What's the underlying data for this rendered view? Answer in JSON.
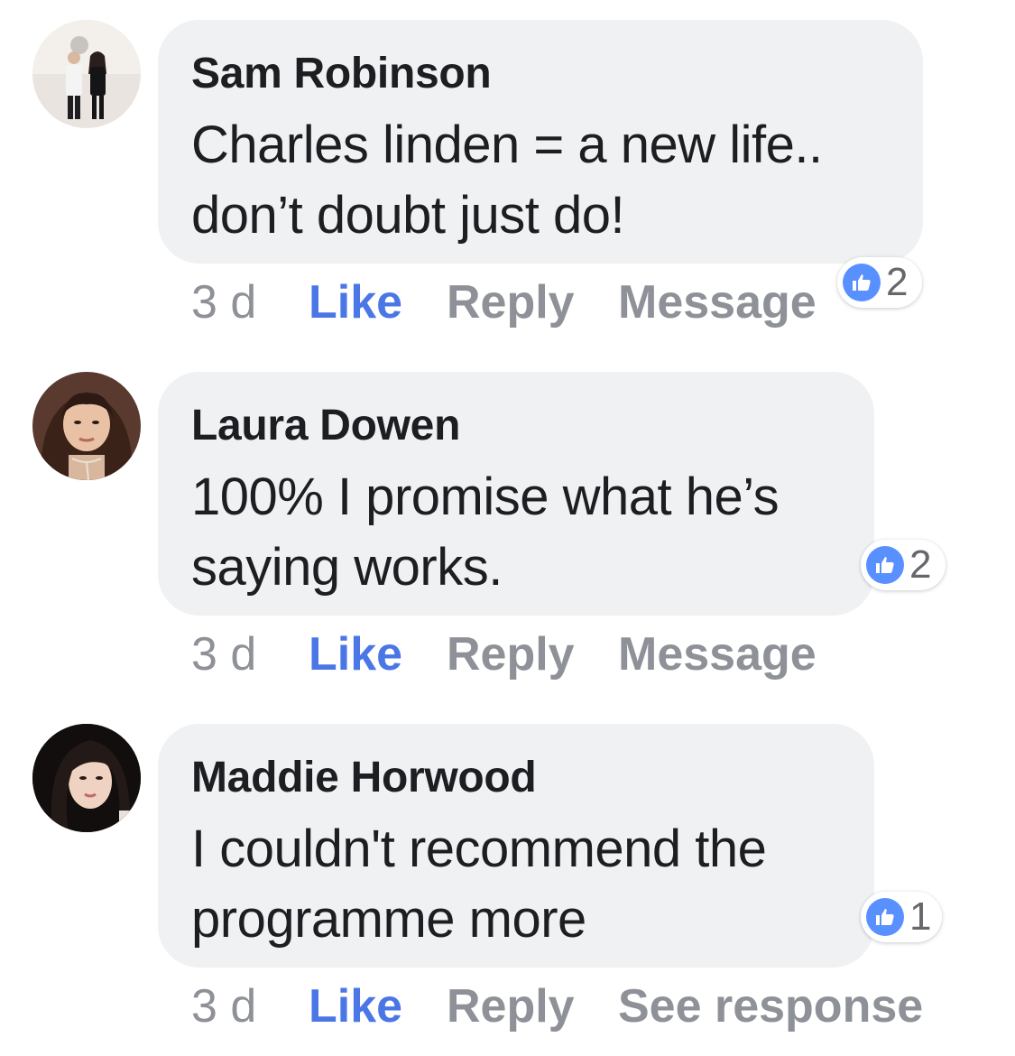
{
  "comments": [
    {
      "author": "Sam Robinson",
      "lines": [
        "Charles linden = a new life..",
        "don’t doubt just do!"
      ],
      "time": "3 d",
      "like_label": "Like",
      "reply_label": "Reply",
      "extra_label": "Message",
      "reaction_count": "2",
      "avatar_icon": "profile-photo"
    },
    {
      "author": "Laura Dowen",
      "lines": [
        "100% I promise what he’s",
        "saying works."
      ],
      "time": "3 d",
      "like_label": "Like",
      "reply_label": "Reply",
      "extra_label": "Message",
      "reaction_count": "2",
      "avatar_icon": "profile-photo"
    },
    {
      "author": "Maddie Horwood",
      "lines": [
        "I couldn't recommend the",
        "programme more"
      ],
      "time": "3 d",
      "like_label": "Like",
      "reply_label": "Reply",
      "extra_label": "See response",
      "reaction_count": "1",
      "avatar_icon": "profile-photo"
    }
  ],
  "colors": {
    "bubble": "#f0f1f3",
    "like_blue": "#4a76e6",
    "reaction_badge": "#5890ff",
    "muted_text": "#8e9198"
  }
}
